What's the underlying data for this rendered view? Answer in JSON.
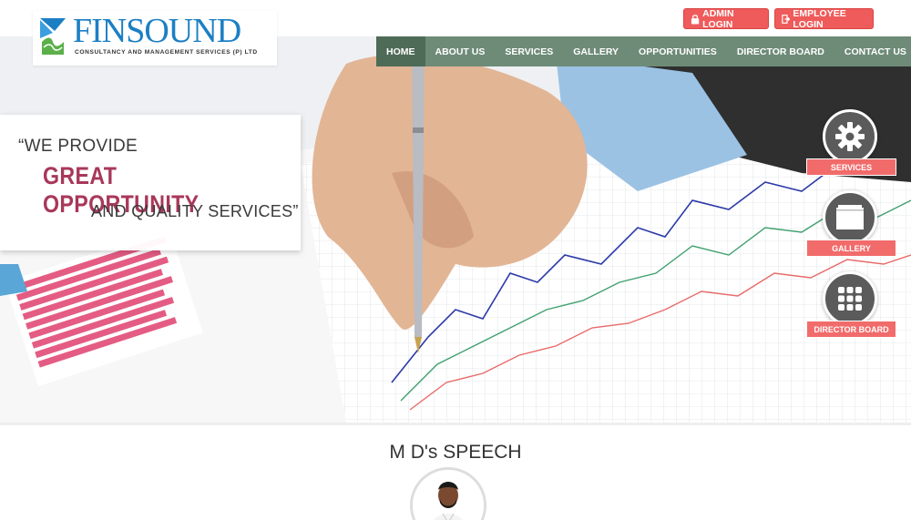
{
  "brand": {
    "name": "FINSOUND",
    "tagline": "CONSULTANCY AND MANAGEMENT SERVICES (P) LTD"
  },
  "header": {
    "admin_login": "ADMIN LOGIN",
    "employee_login": "EMPLOYEE LOGIN"
  },
  "nav": {
    "items": [
      {
        "label": "HOME",
        "active": true
      },
      {
        "label": "ABOUT US",
        "active": false
      },
      {
        "label": "SERVICES",
        "active": false
      },
      {
        "label": "GALLERY",
        "active": false
      },
      {
        "label": "OPPORTUNITIES",
        "active": false
      },
      {
        "label": "DIRECTOR BOARD",
        "active": false
      },
      {
        "label": "CONTACT US",
        "active": false
      }
    ]
  },
  "hero": {
    "line1": "“WE PROVIDE",
    "line2": "GREAT OPPORTUNITY",
    "line3": "AND QUALITY SERVICES”"
  },
  "quick_links": [
    {
      "label": "SERVICES",
      "icon": "gear-icon"
    },
    {
      "label": "GALLERY",
      "icon": "folder-icon"
    },
    {
      "label": "DIRECTOR BOARD",
      "icon": "grid-icon"
    }
  ],
  "speech": {
    "title": "M D's SPEECH"
  },
  "colors": {
    "accent_red": "#ef5b5b",
    "nav_green": "#6e8b78",
    "brand_blue": "#1c7fc4",
    "quote_red": "#a8385a"
  }
}
